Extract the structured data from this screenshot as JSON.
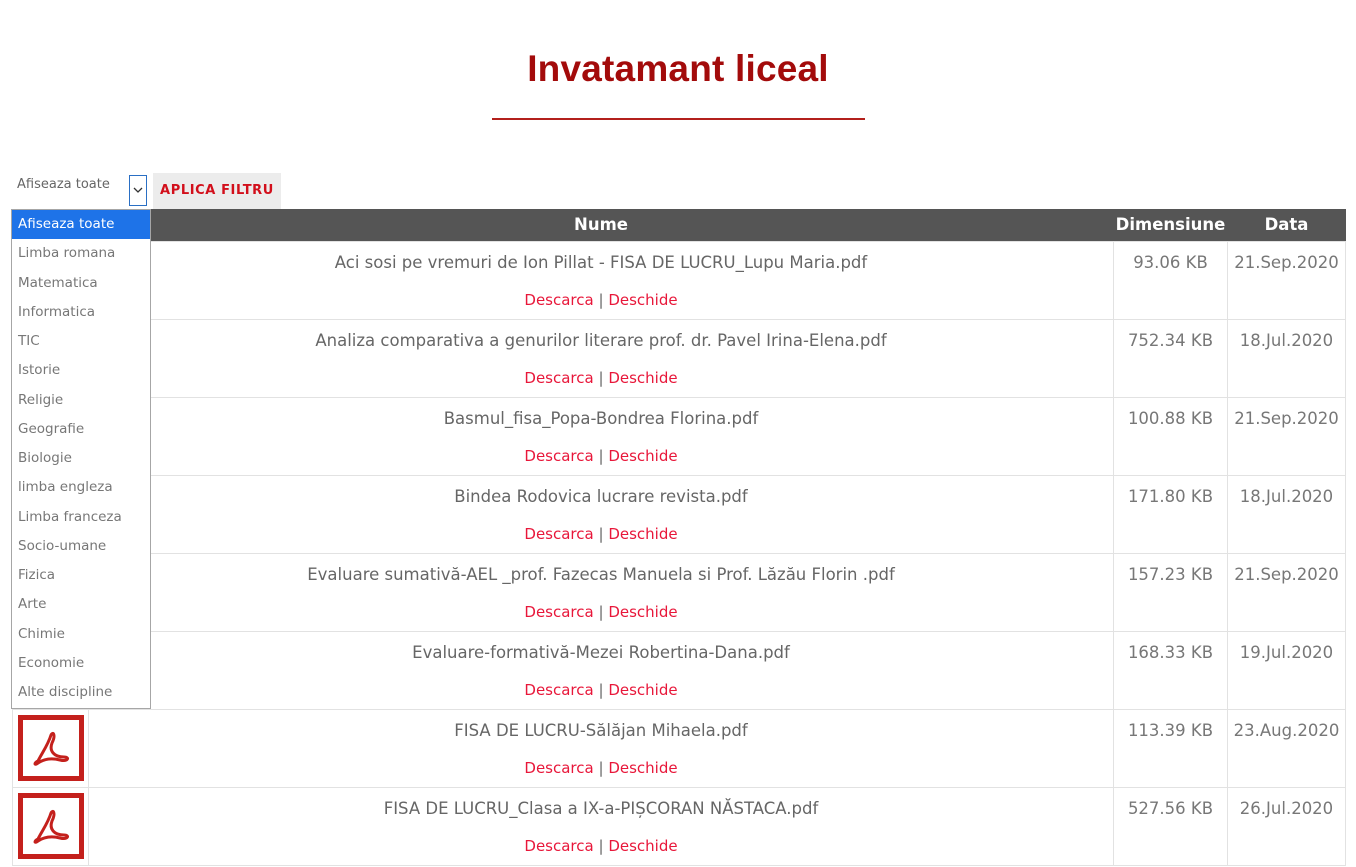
{
  "page": {
    "title": "Invatamant liceal"
  },
  "filter": {
    "selected": "Afiseaza toate",
    "apply_label": "APLICA FILTRU",
    "options": [
      "Afiseaza toate",
      "Limba romana",
      "Matematica",
      "Informatica",
      "TIC",
      "Istorie",
      "Religie",
      "Geografie",
      "Biologie",
      "limba engleza",
      "Limba franceza",
      "Socio-umane",
      "Fizica",
      "Arte",
      "Chimie",
      "Economie",
      "Alte discipline"
    ]
  },
  "table": {
    "headers": {
      "name": "Nume",
      "size": "Dimensiune",
      "date": "Data"
    },
    "link_download": "Descarca",
    "link_separator": "|",
    "link_open": "Deschide",
    "rows": [
      {
        "name": "Aci sosi pe vremuri de Ion Pillat - FISA DE LUCRU_Lupu Maria.pdf",
        "size": "93.06 KB",
        "date": "21.Sep.2020"
      },
      {
        "name": "Analiza comparativa a genurilor literare prof. dr. Pavel Irina-Elena.pdf",
        "size": "752.34 KB",
        "date": "18.Jul.2020"
      },
      {
        "name": "Basmul_fisa_Popa-Bondrea Florina.pdf",
        "size": "100.88 KB",
        "date": "21.Sep.2020"
      },
      {
        "name": "Bindea Rodovica lucrare revista.pdf",
        "size": "171.80 KB",
        "date": "18.Jul.2020"
      },
      {
        "name": "Evaluare sumativă-AEL _prof. Fazecas Manuela si Prof. Lăzău Florin .pdf",
        "size": "157.23 KB",
        "date": "21.Sep.2020"
      },
      {
        "name": "Evaluare-formativă-Mezei Robertina-Dana.pdf",
        "size": "168.33 KB",
        "date": "19.Jul.2020"
      },
      {
        "name": "FISA DE LUCRU-Sălăjan Mihaela.pdf",
        "size": "113.39 KB",
        "date": "23.Aug.2020"
      },
      {
        "name": "FISA DE LUCRU_Clasa a IX-a-PIȘCORAN NĂSTACA.pdf",
        "size": "527.56 KB",
        "date": "26.Jul.2020"
      }
    ]
  },
  "icons": {
    "file": "pdf-icon",
    "dropdown": "chevron-down-icon"
  },
  "colors": {
    "title": "#a30b0b",
    "accent": "#e8173a",
    "header_bg": "#555555",
    "selected_option": "#1e73e8",
    "pdf": "#c4201c"
  }
}
